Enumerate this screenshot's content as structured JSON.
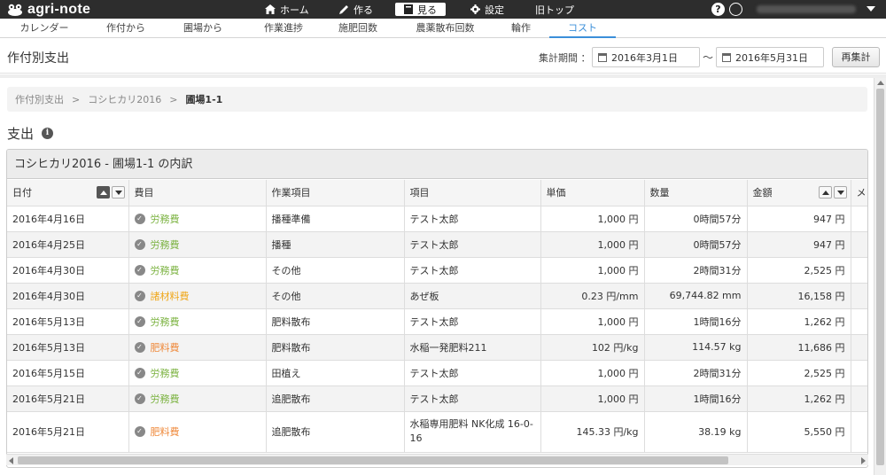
{
  "app": {
    "logo_text": "agri-note"
  },
  "topnav": [
    {
      "label": "ホーム",
      "icon": "home-icon"
    },
    {
      "label": "作る",
      "icon": "pencil-icon"
    },
    {
      "label": "見る",
      "icon": "book-icon",
      "active": true
    },
    {
      "label": "設定",
      "icon": "gear-icon"
    },
    {
      "label": "旧トップ",
      "icon": ""
    }
  ],
  "subtabs": [
    "カレンダー",
    "作付から",
    "圃場から",
    "作業進捗",
    "施肥回数",
    "農薬散布回数",
    "輪作",
    "コスト"
  ],
  "page": {
    "title": "作付別支出",
    "period_label": "集計期間 ：",
    "date_from": "2016年3月1日",
    "date_to": "2016年5月31日",
    "tilde": "〜",
    "recalc_label": "再集計"
  },
  "breadcrumb": [
    "作付別支出",
    ">",
    "コシヒカリ2016",
    ">",
    "圃場1-1"
  ],
  "section": {
    "title": "支出",
    "info_glyph": "i"
  },
  "panel": {
    "title": "コシヒカリ2016 - 圃場1-1 の内訳"
  },
  "table": {
    "headers": [
      "日付",
      "費目",
      "作業項目",
      "項目",
      "単価",
      "数量",
      "金額",
      "メ"
    ],
    "rows": [
      [
        "2016年4月16日",
        "労務費",
        "播種準備",
        "テスト太郎",
        "1,000 円",
        "0時間57分",
        "947 円"
      ],
      [
        "2016年4月25日",
        "労務費",
        "播種",
        "テスト太郎",
        "1,000 円",
        "0時間57分",
        "947 円"
      ],
      [
        "2016年4月30日",
        "労務費",
        "その他",
        "テスト太郎",
        "1,000 円",
        "2時間31分",
        "2,525 円"
      ],
      [
        "2016年4月30日",
        "諸材料費",
        "その他",
        "あぜ板",
        "0.23 円/mm",
        "69,744.82 mm",
        "16,158 円"
      ],
      [
        "2016年5月13日",
        "労務費",
        "肥料散布",
        "テスト太郎",
        "1,000 円",
        "1時間16分",
        "1,262 円"
      ],
      [
        "2016年5月13日",
        "肥料費",
        "肥料散布",
        "水稲一発肥料211",
        "102 円/kg",
        "114.57 kg",
        "11,686 円"
      ],
      [
        "2016年5月15日",
        "労務費",
        "田植え",
        "テスト太郎",
        "1,000 円",
        "2時間31分",
        "2,525 円"
      ],
      [
        "2016年5月21日",
        "労務費",
        "追肥散布",
        "テスト太郎",
        "1,000 円",
        "1時間16分",
        "1,262 円"
      ],
      [
        "2016年5月21日",
        "肥料費",
        "追肥散布",
        "水稲専用肥料 NK化成 16-0-16",
        "145.33 円/kg",
        "38.19 kg",
        "5,550 円"
      ]
    ]
  },
  "colors": {
    "労務費": "#7cb342",
    "諸材料費": "#f0a81c",
    "肥料費": "#ef8a3c",
    "accent": "#3b8fd9",
    "topbar": "#2d2d2d"
  }
}
